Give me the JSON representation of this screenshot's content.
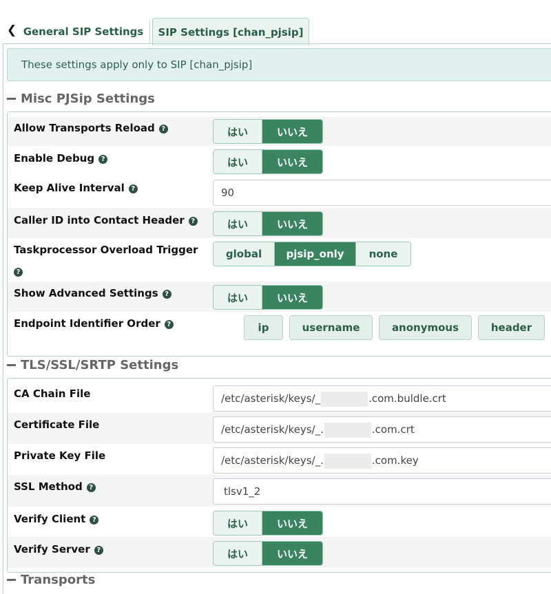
{
  "tabs": {
    "back_icon": "chevron-left-icon",
    "items": [
      {
        "label": "General SIP Settings"
      },
      {
        "label": "SIP Settings [chan_pjsip]"
      }
    ]
  },
  "notice": "These settings apply only to SIP [chan_pjsip]",
  "sections": {
    "misc": {
      "title": "Misc PJSip Settings",
      "allow_transports_reload": {
        "label": "Allow Transports Reload",
        "options": [
          "はい",
          "いいえ"
        ],
        "selected": "いいえ"
      },
      "enable_debug": {
        "label": "Enable Debug",
        "options": [
          "はい",
          "いいえ"
        ],
        "selected": "いいえ"
      },
      "keep_alive_interval": {
        "label": "Keep Alive Interval",
        "value": "90"
      },
      "caller_id_contact": {
        "label": "Caller ID into Contact Header",
        "options": [
          "はい",
          "いいえ"
        ],
        "selected": "いいえ"
      },
      "taskprocessor": {
        "label": "Taskprocessor Overload Trigger",
        "options": [
          "global",
          "pjsip_only",
          "none"
        ],
        "selected": "pjsip_only"
      },
      "show_advanced": {
        "label": "Show Advanced Settings",
        "options": [
          "はい",
          "いいえ"
        ],
        "selected": "いいえ"
      },
      "endpoint_identifier": {
        "label": "Endpoint Identifier Order",
        "items": [
          "ip",
          "username",
          "anonymous",
          "header"
        ]
      }
    },
    "tls": {
      "title": "TLS/SSL/SRTP Settings",
      "ca_chain": {
        "label": "CA Chain File",
        "prefix": "/etc/asterisk/keys/_",
        "suffix": ".com.buldle.crt"
      },
      "certificate": {
        "label": "Certificate File",
        "prefix": "/etc/asterisk/keys/_.",
        "suffix": ".com.crt"
      },
      "private_key": {
        "label": "Private Key File",
        "prefix": "/etc/asterisk/keys/_.",
        "suffix": ".com.key"
      },
      "ssl_method": {
        "label": "SSL Method",
        "value": "tlsv1_2"
      },
      "verify_client": {
        "label": "Verify Client",
        "options": [
          "はい",
          "いいえ"
        ],
        "selected": "いいえ"
      },
      "verify_server": {
        "label": "Verify Server",
        "options": [
          "はい",
          "いいえ"
        ],
        "selected": "いいえ"
      }
    },
    "transports": {
      "title": "Transports"
    }
  },
  "colors": {
    "accent": "#3b8462",
    "accent_light": "#eaf3ef",
    "notice_bg": "#e3f1ee"
  }
}
